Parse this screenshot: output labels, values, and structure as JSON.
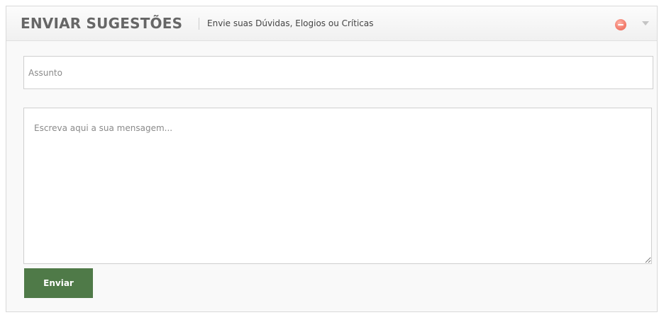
{
  "header": {
    "title": "ENVIAR SUGESTÕES",
    "subtitle": "Envie suas Dúvidas, Elogios ou Críticas",
    "close_icon": "close-icon",
    "collapse_icon": "chevron-down-icon",
    "close_color": "#f27c6c"
  },
  "form": {
    "subject": {
      "placeholder": "Assunto",
      "value": ""
    },
    "message": {
      "placeholder": "Escreva aqui a sua mensagem...",
      "value": ""
    },
    "submit_label": "Enviar",
    "submit_color": "#4f7a48"
  }
}
